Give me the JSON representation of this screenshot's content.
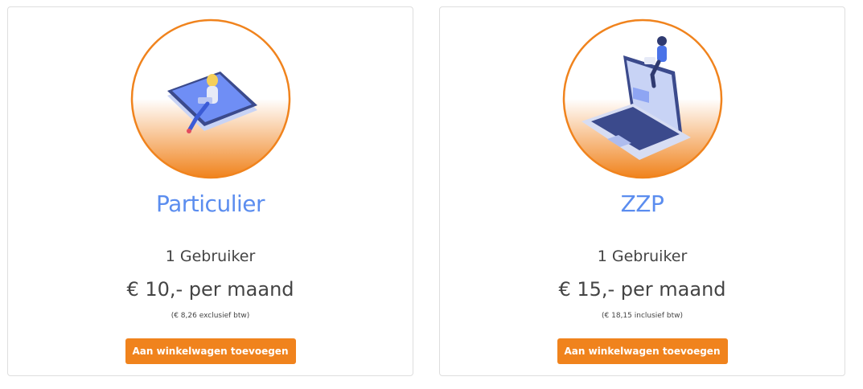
{
  "plans": [
    {
      "title": "Particulier",
      "users": "1 Gebruiker",
      "price": "€ 10,- per maand",
      "tax_note": "(€ 8,26 exclusief btw)",
      "button_label": "Aan winkelwagen toevoegen",
      "illustration": "person-sitting-on-smartphone-icon"
    },
    {
      "title": "ZZP",
      "users": "1 Gebruiker",
      "price": "€ 15,- per maand",
      "tax_note": "(€ 18,15 inclusief btw)",
      "button_label": "Aan winkelwagen toevoegen",
      "illustration": "person-sitting-on-laptop-icon"
    }
  ],
  "colors": {
    "accent_orange": "#f0831d",
    "title_blue": "#5b8def",
    "text": "#444444",
    "card_border": "#dedede"
  }
}
